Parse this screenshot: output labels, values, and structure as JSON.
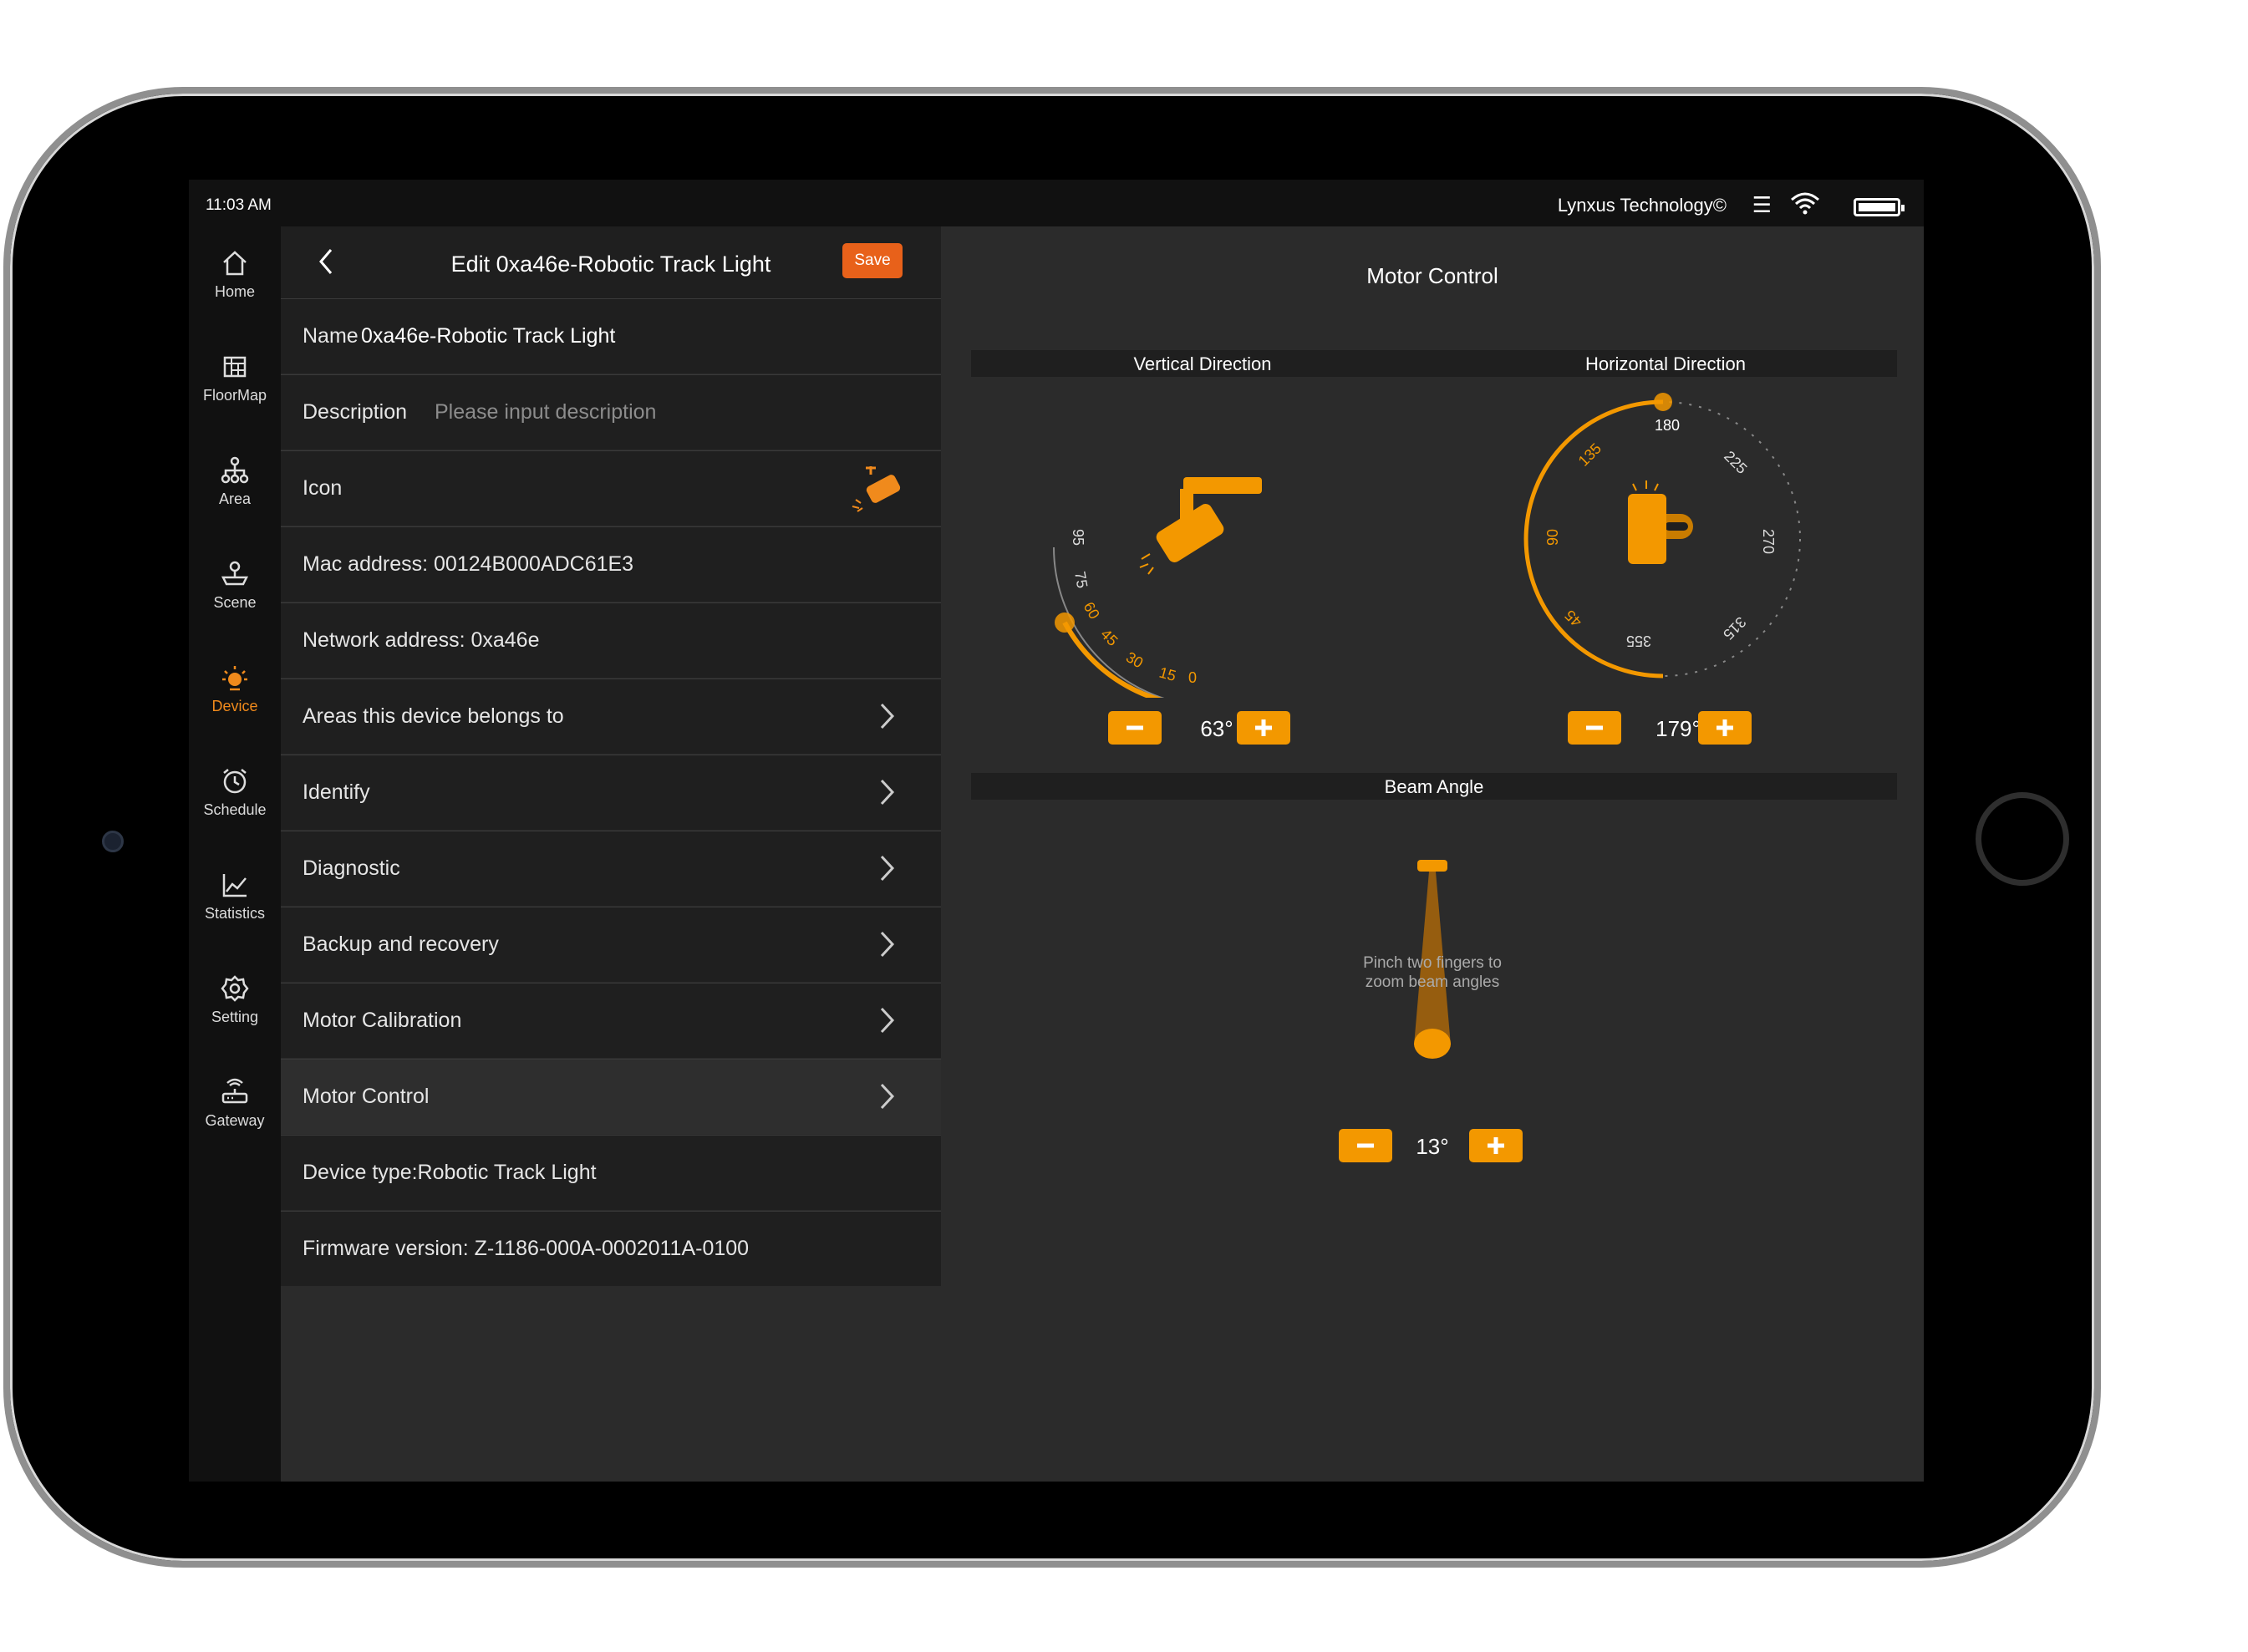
{
  "status": {
    "time": "11:03 AM",
    "brand": "Lynxus Technology©"
  },
  "sidebar": {
    "items": [
      {
        "label": "Home",
        "icon": "home-icon"
      },
      {
        "label": "FloorMap",
        "icon": "floormap-icon"
      },
      {
        "label": "Area",
        "icon": "area-icon"
      },
      {
        "label": "Scene",
        "icon": "scene-icon"
      },
      {
        "label": "Device",
        "icon": "device-icon"
      },
      {
        "label": "Schedule",
        "icon": "schedule-icon"
      },
      {
        "label": "Statistics",
        "icon": "statistics-icon"
      },
      {
        "label": "Setting",
        "icon": "setting-icon"
      },
      {
        "label": "Gateway",
        "icon": "gateway-icon"
      }
    ],
    "active": "Device"
  },
  "editor": {
    "title": "Edit 0xa46e-Robotic Track Light",
    "save_label": "Save",
    "name_label": "Name",
    "name_value": "0xa46e-Robotic Track Light",
    "description_label": "Description",
    "description_placeholder": "Please input description",
    "icon_label": "Icon",
    "mac_address": "Mac address: 00124B000ADC61E3",
    "network_address": "Network address:  0xa46e",
    "menu": [
      "Areas this device belongs to",
      "Identify",
      "Diagnostic",
      "Backup and recovery",
      "Motor Calibration",
      "Motor Control"
    ],
    "selected_menu": "Motor Control",
    "device_type": "Device type:Robotic Track Light",
    "firmware": "Firmware version: Z-1186-000A-0002011A-0100"
  },
  "motor": {
    "title": "Motor Control",
    "vertical": {
      "label": "Vertical Direction",
      "value": "63°",
      "ticks": [
        "95",
        "75",
        "60",
        "45",
        "30",
        "15",
        "0"
      ]
    },
    "horizontal": {
      "label": "Horizontal Direction",
      "value": "179°",
      "ticks": [
        "180",
        "225",
        "270",
        "315",
        "355",
        "45",
        "90",
        "135"
      ]
    },
    "beam": {
      "label": "Beam Angle",
      "value": "13°",
      "hint_line1": "Pinch two fingers to",
      "hint_line2": "zoom beam angles"
    }
  },
  "colors": {
    "accent": "#f39800",
    "save": "#e8611a",
    "active_nav": "#f08a1c"
  }
}
